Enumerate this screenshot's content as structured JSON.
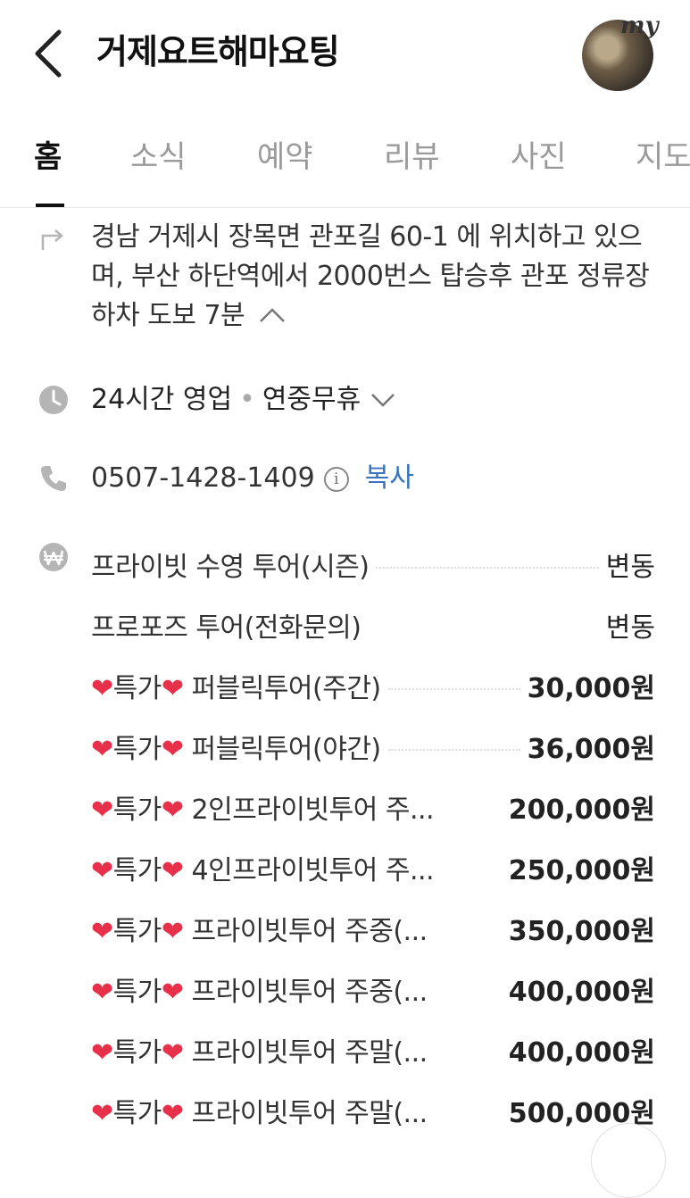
{
  "header": {
    "title": "거제요트해마요팅",
    "avatar_badge": "my"
  },
  "tabs": [
    "홈",
    "소식",
    "예약",
    "리뷰",
    "사진",
    "지도"
  ],
  "address": {
    "text": "경남 거제시 장목면 관포길 60-1 에 위치하고 있으며, 부산 하단역에서 2000번스 탑승후 관포 정류장 하차 도보 7분"
  },
  "hours": {
    "status": "24시간 영업",
    "separator": "•",
    "holiday": "연중무휴"
  },
  "phone": {
    "number": "0507-1428-1409",
    "info_glyph": "i",
    "copy_label": "복사"
  },
  "menu": [
    {
      "name": "프라이빗 수영 투어(시즌)",
      "price": "변동"
    },
    {
      "name": "프로포즈 투어(전화문의)",
      "price": "변동"
    },
    {
      "name": "❤️특가❤️ 퍼블릭투어(주간)",
      "price": "30,000원"
    },
    {
      "name": "❤️특가❤️ 퍼블릭투어(야간)",
      "price": "36,000원"
    },
    {
      "name": "❤️특가❤️ 2인프라이빗투어 주...",
      "price": "200,000원"
    },
    {
      "name": "❤️특가❤️ 4인프라이빗투어 주...",
      "price": "250,000원"
    },
    {
      "name": "❤️특가❤️ 프라이빗투어 주중(...",
      "price": "350,000원"
    },
    {
      "name": "❤️특가❤️ 프라이빗투어 주중(...",
      "price": "400,000원"
    },
    {
      "name": "❤️특가❤️ 프라이빗투어 주말(...",
      "price": "400,000원"
    },
    {
      "name": "❤️특가❤️ 프라이빗투어 주말(...",
      "price": "500,000원"
    }
  ],
  "icons": {
    "back": "chevron-left-icon",
    "directions": "directions-icon",
    "clock": "clock-icon",
    "phone": "phone-icon",
    "won": "won-icon",
    "collapse": "chevron-up-icon",
    "expand": "chevron-down-icon"
  },
  "colors": {
    "accent_link": "#3873c2",
    "heart": "#e8304b",
    "icon_gray": "#b5b5b5"
  }
}
